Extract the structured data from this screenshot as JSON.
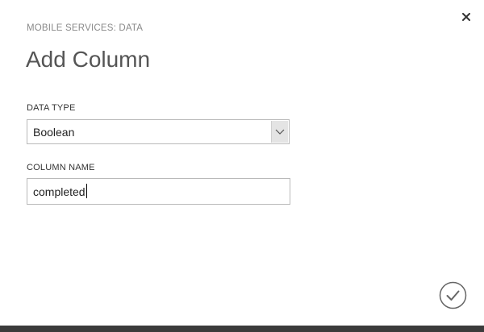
{
  "dialog": {
    "subtitle": "MOBILE SERVICES: DATA",
    "title": "Add Column",
    "close_icon": "close-icon",
    "confirm_icon": "checkmark-icon"
  },
  "form": {
    "data_type": {
      "label": "DATA TYPE",
      "selected": "Boolean",
      "arrow_icon": "chevron-down-icon"
    },
    "column_name": {
      "label": "COLUMN NAME",
      "value": "completed"
    }
  },
  "colors": {
    "title": "#555555",
    "subtitle": "#8a8a8a",
    "border": "#b9b9b9",
    "bottom_bar": "#3b3b3b"
  }
}
